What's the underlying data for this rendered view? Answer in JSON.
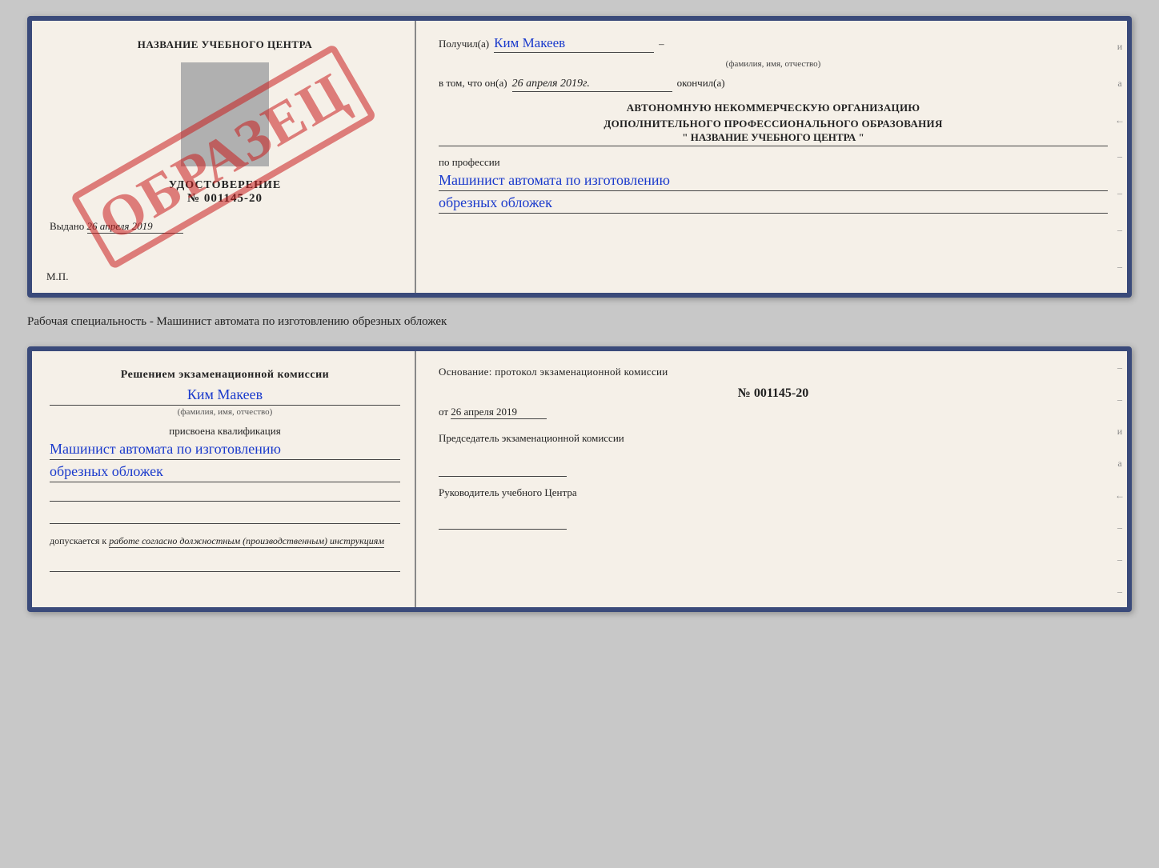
{
  "top_card": {
    "left": {
      "school_name": "НАЗВАНИЕ УЧЕБНОГО ЦЕНТРА",
      "cert_label": "УДОСТОВЕРЕНИЕ",
      "cert_number": "№ 001145-20",
      "issued_label": "Выдано",
      "issued_date": "26 апреля 2019",
      "mp_label": "М.П.",
      "stamp_text": "ОБРАЗЕЦ"
    },
    "right": {
      "received_label": "Получил(а)",
      "received_name": "Ким Макеев",
      "received_sub": "(фамилия, имя, отчество)",
      "date_label": "в том, что он(а)",
      "date_value": "26 апреля 2019г.",
      "finished_label": "окончил(а)",
      "org_line1": "АВТОНОМНУЮ НЕКОММЕРЧЕСКУЮ ОРГАНИЗАЦИЮ",
      "org_line2": "ДОПОЛНИТЕЛЬНОГО ПРОФЕССИОНАЛЬНОГО ОБРАЗОВАНИЯ",
      "org_quotes": "\"",
      "org_name": "НАЗВАНИЕ УЧЕБНОГО ЦЕНТРА",
      "org_close_quotes": "\"",
      "profession_label": "по профессии",
      "profession_line1": "Машинист автомата по изготовлению",
      "profession_line2": "обрезных обложек",
      "side_chars": [
        "и",
        "а",
        "←",
        "–",
        "–",
        "–",
        "–"
      ]
    }
  },
  "separator": {
    "text": "Рабочая специальность - Машинист автомата по изготовлению обрезных обложек"
  },
  "bottom_card": {
    "left": {
      "heading": "Решением экзаменационной комиссии",
      "name_hw": "Ким Макеев",
      "name_sub": "(фамилия, имя, отчество)",
      "qual_label": "присвоена квалификация",
      "qual_line1": "Машинист автомата по изготовлению",
      "qual_line2": "обрезных обложек",
      "allowed_prefix": "допускается к",
      "allowed_text": "работе согласно должностным (производственным) инструкциям"
    },
    "right": {
      "heading": "Основание: протокол экзаменационной комиссии",
      "number": "№ 001145-20",
      "date_prefix": "от",
      "date_value": "26 апреля 2019",
      "chairman_label": "Председатель экзаменационной комиссии",
      "director_label": "Руководитель учебного Центра",
      "side_chars": [
        "–",
        "–",
        "и",
        "а",
        "←",
        "–",
        "–",
        "–"
      ]
    }
  }
}
